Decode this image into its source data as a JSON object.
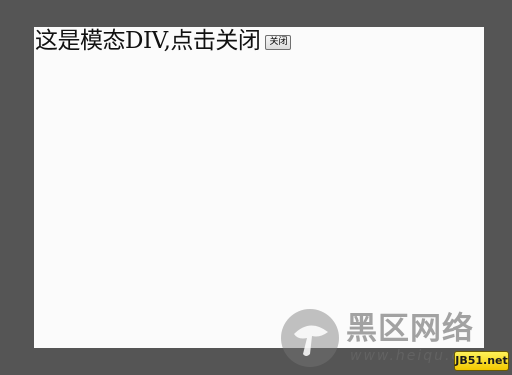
{
  "modal": {
    "message": "这是模态DIV,点击关闭",
    "close_label": "关闭"
  },
  "watermark": {
    "title": "黑区网络",
    "url": "www.heiqu.com",
    "badge": "JB51.net"
  },
  "colors": {
    "overlay": "#555555",
    "modal_bg": "#fbfbfb",
    "badge_bg": "#f2c800"
  },
  "icons": [
    "mushroom-logo-icon"
  ]
}
